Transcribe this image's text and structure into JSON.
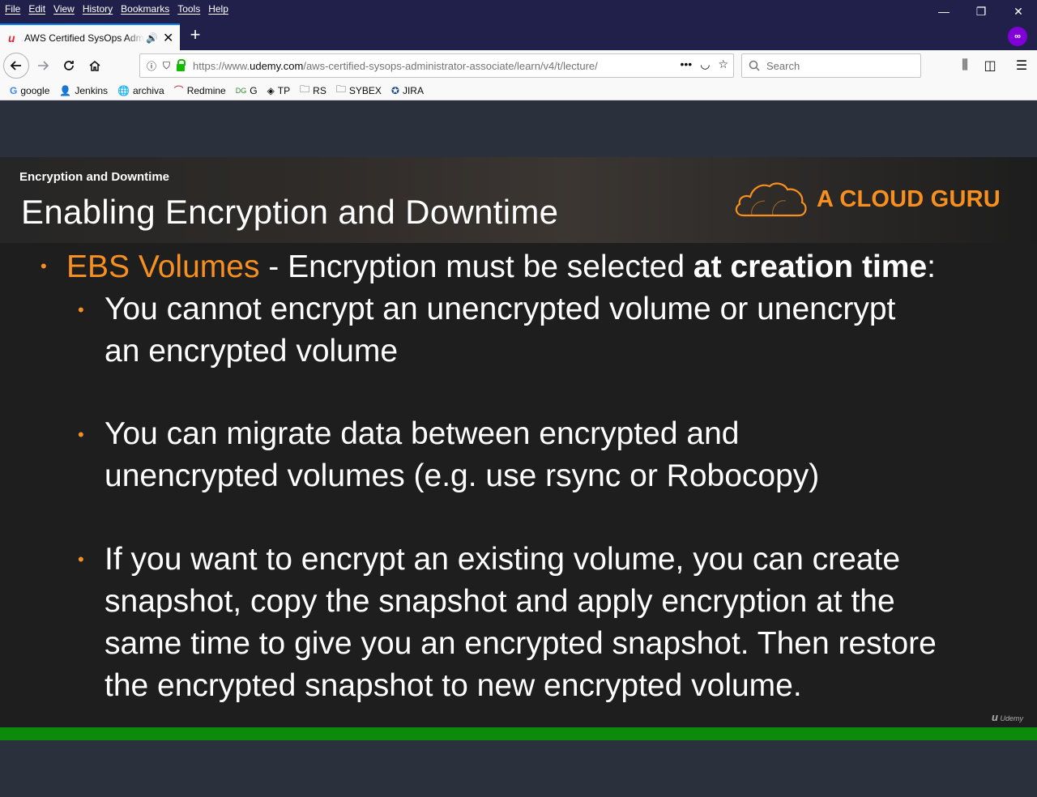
{
  "menu": [
    "File",
    "Edit",
    "View",
    "History",
    "Bookmarks",
    "Tools",
    "Help"
  ],
  "window_controls": {
    "minimize": "—",
    "restore": "❐",
    "close": "✕"
  },
  "tab": {
    "title": "AWS Certified SysOps Administrator",
    "close": "✕"
  },
  "new_tab": "+",
  "urlbar": {
    "url_prefix": "https://www.",
    "url_host": "udemy.com",
    "url_path": "/aws-certified-sysops-administrator-associate/learn/v4/t/lecture/",
    "more": "•••"
  },
  "searchbar": {
    "placeholder": "Search"
  },
  "bookmarks": [
    {
      "label": "google",
      "icon": "google-icon"
    },
    {
      "label": "Jenkins",
      "icon": "jenkins-icon"
    },
    {
      "label": "archiva",
      "icon": "globe-icon"
    },
    {
      "label": "Redmine",
      "icon": "redmine-icon"
    },
    {
      "label": "G",
      "icon": "link-icon"
    },
    {
      "label": "TP",
      "icon": "tp-icon"
    },
    {
      "label": "RS",
      "icon": "folder-icon"
    },
    {
      "label": "SYBEX",
      "icon": "folder-icon"
    },
    {
      "label": "JIRA",
      "icon": "jira-icon"
    }
  ],
  "slide": {
    "section": "Encryption and Downtime",
    "title": "Enabling Encryption and Downtime",
    "brand": "A CLOUD GURU",
    "main_bullet": {
      "highlight": "EBS Volumes",
      "text_before_bold": " - Encryption must be selected ",
      "bold": "at creation time",
      "text_after_bold": ":"
    },
    "sub_bullets": [
      [
        "You cannot encrypt an unencrypted volume or unencrypt",
        "an encrypted volume"
      ],
      [
        "You can migrate data between encrypted and",
        "unencrypted volumes (e.g. use rsync or Robocopy)"
      ],
      [
        "If you want to encrypt an existing volume, you can create",
        "snapshot, copy the snapshot and apply encryption at the",
        "same time to give you an encrypted snapshot. Then restore",
        "the encrypted snapshot to new encrypted volume."
      ]
    ],
    "watermark": "Udemy"
  },
  "colors": {
    "accent": "#f7901e",
    "progress": "#0b8a0b",
    "chrome": "#20204a"
  }
}
